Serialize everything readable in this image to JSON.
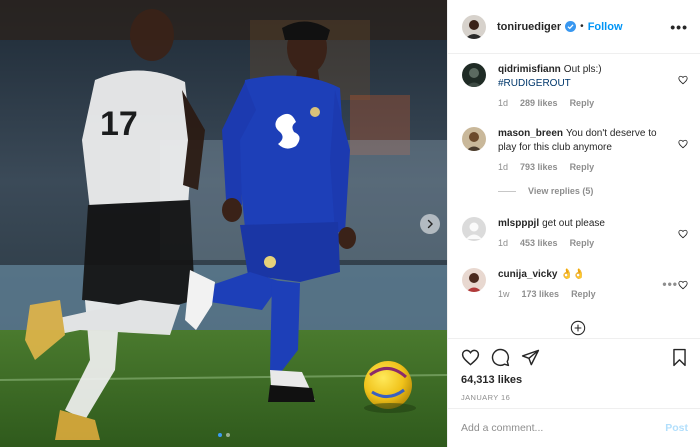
{
  "post": {
    "author": "toniruediger",
    "separator": "•",
    "follow_label": "Follow",
    "more_label": "•••",
    "carousel": {
      "total": 2,
      "current": 1
    }
  },
  "comments": [
    {
      "user": "qidrimisfiann",
      "text": "Out pls:)",
      "tag": "#RUDIGEROUT",
      "age": "1d",
      "likes": "289 likes",
      "reply": "Reply"
    },
    {
      "user": "mason_breen",
      "text": "You don't deserve to play for this club anymore",
      "age": "1d",
      "likes": "793 likes",
      "reply": "Reply",
      "view_replies": "View replies (5)"
    },
    {
      "user": "mlspppjl",
      "text": "get out please",
      "age": "1d",
      "likes": "453 likes",
      "reply": "Reply"
    },
    {
      "user": "cunija_vicky",
      "text": "👌👌",
      "age": "1w",
      "likes": "173 likes",
      "reply": "Reply",
      "options": "•••"
    }
  ],
  "stats": {
    "likes": "64,313 likes",
    "date": "JANUARY 16"
  },
  "add_comment": {
    "placeholder": "Add a comment...",
    "post_label": "Post"
  },
  "icons": {
    "heart": "heart-icon",
    "comment": "comment-icon",
    "share": "share-icon",
    "save": "bookmark-icon",
    "verified": "verified-badge-icon",
    "next": "chevron-right-icon",
    "load_more": "plus-circle-icon"
  },
  "colors": {
    "accent": "#0095f6",
    "muted": "#8e8e8e",
    "border": "#efefef",
    "post_disabled": "#b2dffc",
    "kit": "#1d3fb8"
  }
}
